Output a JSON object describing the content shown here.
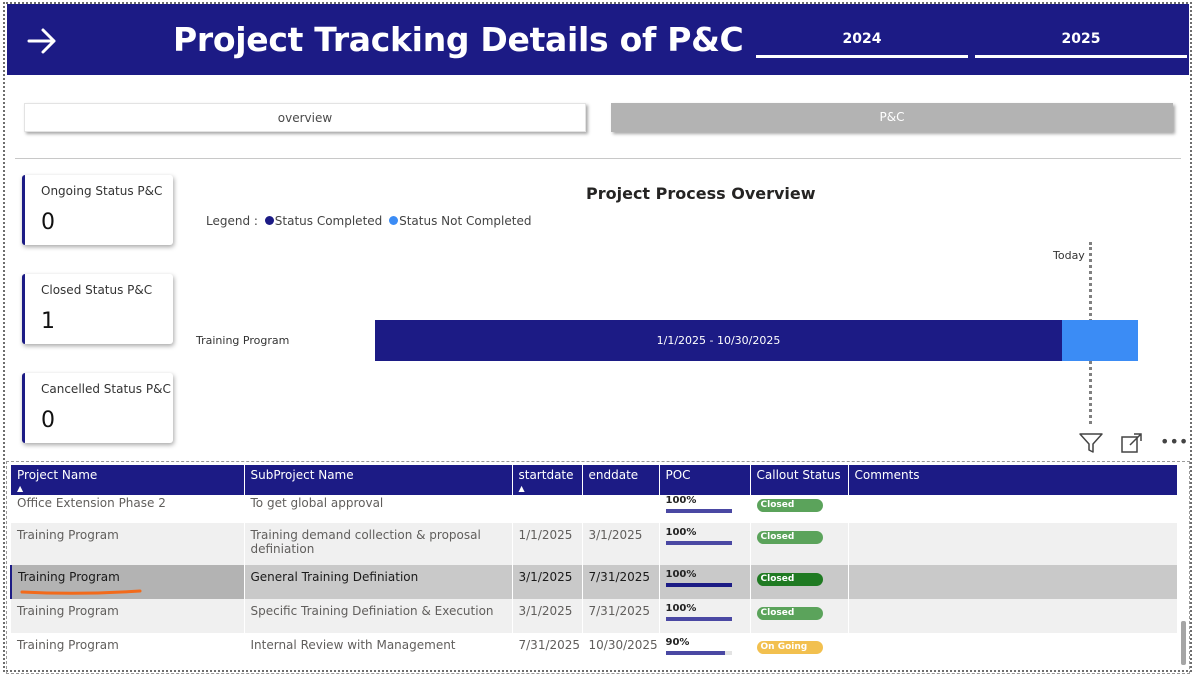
{
  "header": {
    "title": "Project Tracking Details of P&C",
    "years": [
      "2024",
      "2025"
    ],
    "bg_color": "#1c1b85",
    "arrow_icon": "arrow-right-icon"
  },
  "tabs": {
    "overview": "overview",
    "pc": "P&C"
  },
  "cards": [
    {
      "label": "Ongoing Status P&C",
      "value": "0"
    },
    {
      "label": "Closed Status P&C",
      "value": "1"
    },
    {
      "label": "Cancelled Status P&C",
      "value": "0"
    }
  ],
  "gantt": {
    "title": "Project Process Overview",
    "legend_prefix": "Legend :",
    "legend_completed": "Status Completed",
    "legend_not_completed": "Status Not Completed",
    "today_label": "Today",
    "row_label": "Training Program",
    "bar_label": "1/1/2025  -  10/30/2025",
    "completed_color": "#1c1b85",
    "not_completed_color": "#3b8cf5"
  },
  "table": {
    "headers": [
      "Project Name",
      "SubProject Name",
      "startdate",
      "enddate",
      "POC",
      "Callout Status",
      "Comments"
    ],
    "rows": [
      {
        "project": "Office Extension Phase 2",
        "subproject": "To get global approval",
        "start": "",
        "end": "",
        "poc": "100%",
        "poc_value": 100,
        "status": "Closed",
        "comments": ""
      },
      {
        "project": "Training Program",
        "subproject": "Training demand collection & proposal definiation",
        "start": "1/1/2025",
        "end": "3/1/2025",
        "poc": "100%",
        "poc_value": 100,
        "status": "Closed",
        "comments": ""
      },
      {
        "project": "Training Program",
        "subproject": "General Training Definiation",
        "start": "3/1/2025",
        "end": "7/31/2025",
        "poc": "100%",
        "poc_value": 100,
        "status": "Closed",
        "comments": ""
      },
      {
        "project": "Training Program",
        "subproject": "Specific Training Definiation & Execution",
        "start": "3/1/2025",
        "end": "7/31/2025",
        "poc": "100%",
        "poc_value": 100,
        "status": "Closed",
        "comments": ""
      },
      {
        "project": "Training Program",
        "subproject": "Internal Review with Management",
        "start": "7/31/2025",
        "end": "10/30/2025",
        "poc": "90%",
        "poc_value": 90,
        "status": "On Going",
        "comments": ""
      }
    ]
  },
  "icons": {
    "filter": "filter-icon",
    "expand": "focus-mode-icon",
    "more": "more-options-icon"
  }
}
